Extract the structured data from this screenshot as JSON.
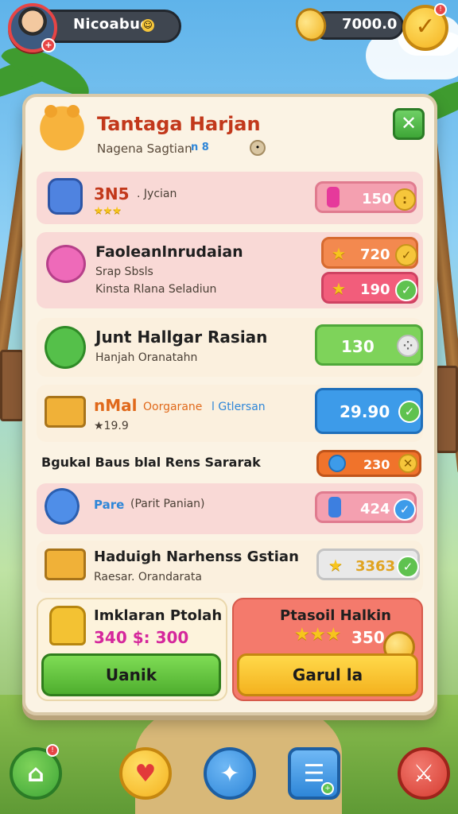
{
  "header": {
    "player_name": "Nicoabuo",
    "coin_value": "7000.0",
    "avatar_badge": "+"
  },
  "panel": {
    "title": "Tantaga Harjan",
    "subtitle": "Nagena Sagtian",
    "subtitle_tags": "n 8"
  },
  "rows": [
    {
      "title": "3N5",
      "title_suffix": ". Jycian",
      "stars": "★★★",
      "price": "150"
    },
    {
      "title": "Faoleanlnrudaian",
      "sub1": "Srap Sbsls",
      "sub2": "Kinsta Rlana Seladiun",
      "price_a": "720",
      "price_b": "190"
    },
    {
      "title": "Junt Hallgar Rasian",
      "sub1": "Hanjah Oranatahn",
      "price": "130"
    },
    {
      "title": "nMal",
      "title_mid": "Oorgarane",
      "title_tail": "l Gtlersan",
      "sub1": "★19.9",
      "price": "29.90"
    },
    {
      "title": "Bgukal Baus blal Rens Sararak",
      "price": "230"
    },
    {
      "title": "Pare",
      "title_tail": "(Parit Panian)",
      "price": "424"
    },
    {
      "title": "Haduigh  Narhenss Gstian",
      "sub1": "Raesar. Orandarata",
      "price": "3363"
    }
  ],
  "cards": {
    "left": {
      "title": "Imklaran Ptolah",
      "price": "340 $: 300",
      "button": "Uanik"
    },
    "right": {
      "title": "Ptasoil Halkin",
      "stars": "★★★",
      "value": "350",
      "button": "Garul la"
    }
  },
  "colors": {
    "title": "#c2381b",
    "green": "#5fc24f",
    "blue": "#3d9be9",
    "pink": "#f9d9d6",
    "orange": "#f0732b"
  }
}
